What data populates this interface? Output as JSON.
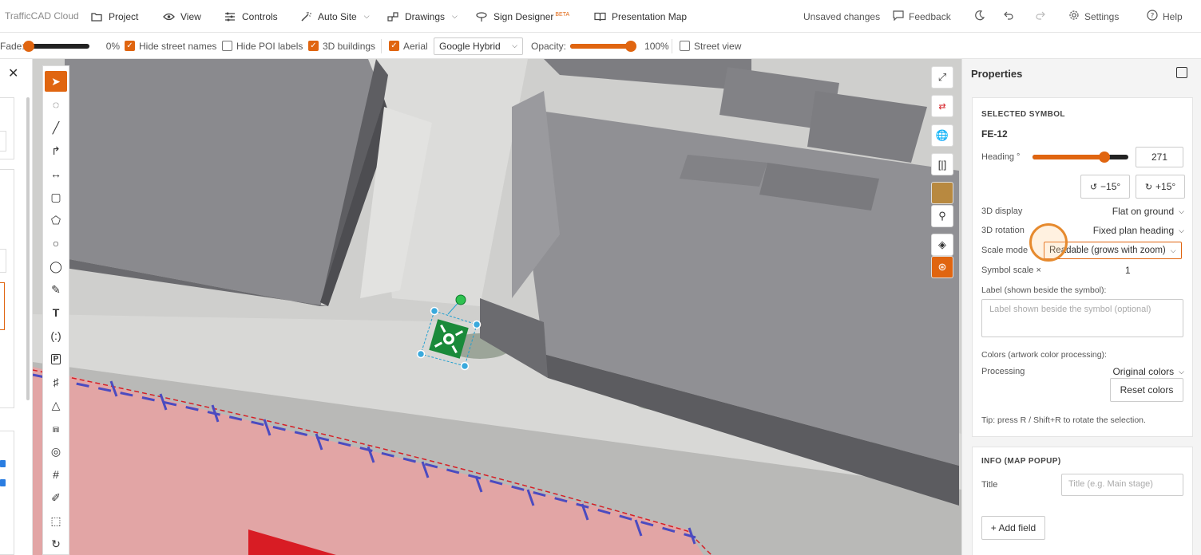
{
  "topbar": {
    "brand": "TrafficCAD Cloud",
    "menu": {
      "project": "Project",
      "view": "View",
      "controls": "Controls",
      "auto_site": "Auto Site",
      "drawings": "Drawings",
      "sign_designer": "Sign Designer",
      "sign_designer_badge": "BETA",
      "presentation_map": "Presentation Map"
    },
    "status": "Unsaved changes",
    "feedback": "Feedback",
    "settings": "Settings",
    "help": "Help"
  },
  "toolbar2": {
    "fade_label": "Fade:",
    "fade_value": "0%",
    "fade_fraction": 0.0,
    "hide_street_names": {
      "label": "Hide street names",
      "checked": true
    },
    "hide_poi_labels": {
      "label": "Hide POI labels",
      "checked": false
    },
    "buildings_3d": {
      "label": "3D buildings",
      "checked": true
    },
    "aerial": {
      "label": "Aerial",
      "checked": true
    },
    "basemap_select": "Google Hybrid",
    "opacity_label": "Opacity:",
    "opacity_value": "100%",
    "opacity_fraction": 1.0,
    "street_view": {
      "label": "Street view",
      "checked": false
    }
  },
  "colors": {
    "accent": "#e06510",
    "selection": "#22a0d0",
    "symbol_green": "#1a8a3a"
  },
  "tools": [
    "select",
    "lasso",
    "line",
    "curve",
    "dimension",
    "rectangle",
    "polygon",
    "circle",
    "ellipse",
    "pencil",
    "text",
    "brackets",
    "parking",
    "grid",
    "triangle",
    "lane",
    "target",
    "hashtag",
    "marker",
    "area-select",
    "rotate"
  ],
  "map_buttons": [
    "expand",
    "direction",
    "globe",
    "split",
    "aerial-thumb",
    "pedestrian",
    "layers",
    "location"
  ],
  "properties": {
    "title": "Properties",
    "selected_symbol": {
      "section_title": "SELECTED SYMBOL",
      "symbol_id": "FE-12",
      "heading_label": "Heading °",
      "heading_value": "271",
      "heading_fraction": 0.75,
      "rotate_minus": "−15°",
      "rotate_plus": "+15°",
      "display_3d_label": "3D display",
      "display_3d_value": "Flat on ground",
      "rotation_3d_label": "3D rotation",
      "rotation_3d_value": "Fixed plan heading",
      "scale_mode_label": "Scale mode",
      "scale_mode_value": "Readable (grows with zoom)",
      "symbol_scale_label": "Symbol scale ×",
      "symbol_scale_value": "1",
      "label_caption": "Label (shown beside the symbol):",
      "label_placeholder": "Label shown beside the symbol (optional)",
      "colors_caption": "Colors (artwork color processing):",
      "processing_label": "Processing",
      "processing_value": "Original colors",
      "reset_colors": "Reset colors",
      "tip": "Tip: press R / Shift+R to rotate the selection."
    },
    "info": {
      "section_title": "INFO (MAP POPUP)",
      "title_label": "Title",
      "title_placeholder": "Title (e.g. Main stage)",
      "add_field": "+ Add field"
    }
  }
}
